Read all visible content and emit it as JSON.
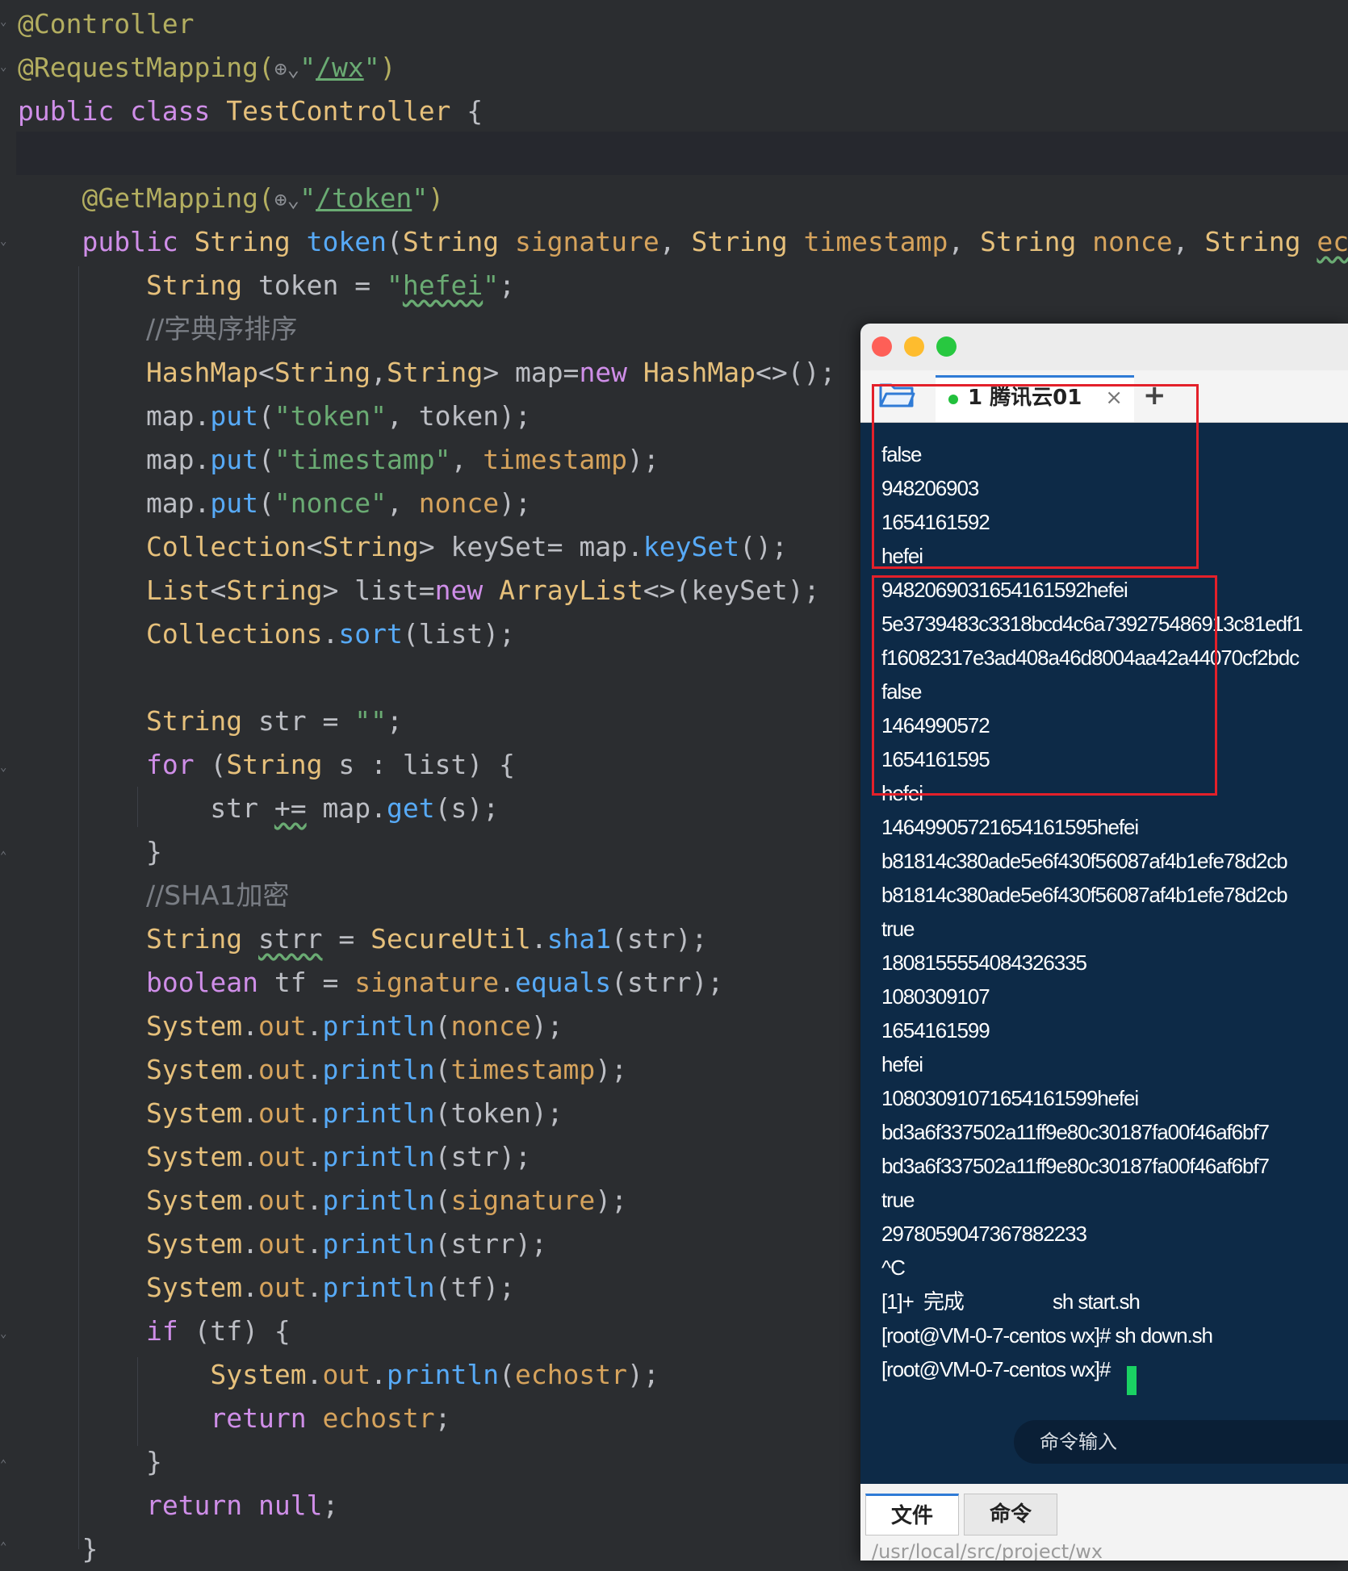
{
  "editor": {
    "lines": [
      [
        {
          "c": "t-ann",
          "t": "@Controller"
        }
      ],
      [
        {
          "c": "t-ann",
          "t": "@RequestMapping("
        },
        {
          "c": "globe",
          "t": "⊕⌄"
        },
        {
          "c": "t-str",
          "t": "\""
        },
        {
          "c": "t-url",
          "t": "/wx"
        },
        {
          "c": "t-str",
          "t": "\""
        },
        {
          "c": "t-ann",
          "t": ")"
        }
      ],
      [
        {
          "c": "t-kw",
          "t": "public class "
        },
        {
          "c": "t-type",
          "t": "TestController"
        },
        {
          "c": "t-pl",
          "t": " {"
        }
      ],
      [],
      [
        {
          "c": "t-pl",
          "t": "    "
        },
        {
          "c": "t-ann",
          "t": "@GetMapping("
        },
        {
          "c": "globe",
          "t": "⊕⌄"
        },
        {
          "c": "t-str",
          "t": "\""
        },
        {
          "c": "t-url",
          "t": "/token"
        },
        {
          "c": "t-str",
          "t": "\""
        },
        {
          "c": "t-ann",
          "t": ")"
        }
      ],
      [
        {
          "c": "t-pl",
          "t": "    "
        },
        {
          "c": "t-kw",
          "t": "public "
        },
        {
          "c": "t-type",
          "t": "String "
        },
        {
          "c": "t-fn",
          "t": "token"
        },
        {
          "c": "t-pl",
          "t": "("
        },
        {
          "c": "t-type",
          "t": "String "
        },
        {
          "c": "t-prm",
          "t": "signature"
        },
        {
          "c": "t-pl",
          "t": ", "
        },
        {
          "c": "t-type",
          "t": "String "
        },
        {
          "c": "t-prm",
          "t": "timestamp"
        },
        {
          "c": "t-pl",
          "t": ", "
        },
        {
          "c": "t-type",
          "t": "String "
        },
        {
          "c": "t-prm",
          "t": "nonce"
        },
        {
          "c": "t-pl",
          "t": ", "
        },
        {
          "c": "t-type",
          "t": "String "
        },
        {
          "c": "t-prm wavy",
          "t": "echos"
        }
      ],
      [
        {
          "c": "t-pl",
          "t": "        "
        },
        {
          "c": "t-type",
          "t": "String "
        },
        {
          "c": "t-pl",
          "t": "token = "
        },
        {
          "c": "t-str",
          "t": "\""
        },
        {
          "c": "t-str wavy",
          "t": "hefei"
        },
        {
          "c": "t-str",
          "t": "\""
        },
        {
          "c": "t-pl",
          "t": ";"
        }
      ],
      [
        {
          "c": "t-pl",
          "t": "        "
        },
        {
          "c": "t-cm",
          "t": "//字典序排序"
        }
      ],
      [
        {
          "c": "t-pl",
          "t": "        "
        },
        {
          "c": "t-type",
          "t": "HashMap"
        },
        {
          "c": "t-pl",
          "t": "<"
        },
        {
          "c": "t-type",
          "t": "String"
        },
        {
          "c": "t-pl",
          "t": ","
        },
        {
          "c": "t-type",
          "t": "String"
        },
        {
          "c": "t-pl",
          "t": "> map="
        },
        {
          "c": "t-kw",
          "t": "new "
        },
        {
          "c": "t-type",
          "t": "HashMap"
        },
        {
          "c": "t-pl",
          "t": "<>();"
        }
      ],
      [
        {
          "c": "t-pl",
          "t": "        map."
        },
        {
          "c": "t-fn",
          "t": "put"
        },
        {
          "c": "t-pl",
          "t": "("
        },
        {
          "c": "t-str",
          "t": "\"token\""
        },
        {
          "c": "t-pl",
          "t": ", token);"
        }
      ],
      [
        {
          "c": "t-pl",
          "t": "        map."
        },
        {
          "c": "t-fn",
          "t": "put"
        },
        {
          "c": "t-pl",
          "t": "("
        },
        {
          "c": "t-str",
          "t": "\"timestamp\""
        },
        {
          "c": "t-pl",
          "t": ", "
        },
        {
          "c": "t-prm",
          "t": "timestamp"
        },
        {
          "c": "t-pl",
          "t": ");"
        }
      ],
      [
        {
          "c": "t-pl",
          "t": "        map."
        },
        {
          "c": "t-fn",
          "t": "put"
        },
        {
          "c": "t-pl",
          "t": "("
        },
        {
          "c": "t-str",
          "t": "\"nonce\""
        },
        {
          "c": "t-pl",
          "t": ", "
        },
        {
          "c": "t-prm",
          "t": "nonce"
        },
        {
          "c": "t-pl",
          "t": ");"
        }
      ],
      [
        {
          "c": "t-pl",
          "t": "        "
        },
        {
          "c": "t-type",
          "t": "Collection"
        },
        {
          "c": "t-pl",
          "t": "<"
        },
        {
          "c": "t-type",
          "t": "String"
        },
        {
          "c": "t-pl",
          "t": "> keySet= map."
        },
        {
          "c": "t-fn",
          "t": "keySet"
        },
        {
          "c": "t-pl",
          "t": "();"
        }
      ],
      [
        {
          "c": "t-pl",
          "t": "        "
        },
        {
          "c": "t-type",
          "t": "List"
        },
        {
          "c": "t-pl",
          "t": "<"
        },
        {
          "c": "t-type",
          "t": "String"
        },
        {
          "c": "t-pl",
          "t": "> list="
        },
        {
          "c": "t-kw",
          "t": "new "
        },
        {
          "c": "t-type",
          "t": "ArrayList"
        },
        {
          "c": "t-pl",
          "t": "<>(keySet);"
        }
      ],
      [
        {
          "c": "t-pl",
          "t": "        "
        },
        {
          "c": "t-type",
          "t": "Collections"
        },
        {
          "c": "t-pl",
          "t": "."
        },
        {
          "c": "t-fn",
          "t": "sort"
        },
        {
          "c": "t-pl",
          "t": "(list);"
        }
      ],
      [],
      [
        {
          "c": "t-pl",
          "t": "        "
        },
        {
          "c": "t-type",
          "t": "String "
        },
        {
          "c": "t-pl",
          "t": "str = "
        },
        {
          "c": "t-str",
          "t": "\"\""
        },
        {
          "c": "t-pl",
          "t": ";"
        }
      ],
      [
        {
          "c": "t-pl",
          "t": "        "
        },
        {
          "c": "t-kw",
          "t": "for "
        },
        {
          "c": "t-pl",
          "t": "("
        },
        {
          "c": "t-type",
          "t": "String "
        },
        {
          "c": "t-pl",
          "t": "s : list) {"
        }
      ],
      [
        {
          "c": "t-pl",
          "t": "            str "
        },
        {
          "c": "t-pl wavy",
          "t": "+="
        },
        {
          "c": "t-pl",
          "t": " map."
        },
        {
          "c": "t-fn",
          "t": "get"
        },
        {
          "c": "t-pl",
          "t": "(s);"
        }
      ],
      [
        {
          "c": "t-pl",
          "t": "        }"
        }
      ],
      [
        {
          "c": "t-pl",
          "t": "        "
        },
        {
          "c": "t-cm",
          "t": "//SHA1加密"
        }
      ],
      [
        {
          "c": "t-pl",
          "t": "        "
        },
        {
          "c": "t-type",
          "t": "String "
        },
        {
          "c": "t-pl wavy",
          "t": "strr"
        },
        {
          "c": "t-pl",
          "t": " = "
        },
        {
          "c": "t-type",
          "t": "SecureUtil"
        },
        {
          "c": "t-pl",
          "t": "."
        },
        {
          "c": "t-fn",
          "t": "sha1"
        },
        {
          "c": "t-pl",
          "t": "(str);"
        }
      ],
      [
        {
          "c": "t-pl",
          "t": "        "
        },
        {
          "c": "t-kw",
          "t": "boolean "
        },
        {
          "c": "t-pl",
          "t": "tf = "
        },
        {
          "c": "t-prm",
          "t": "signature"
        },
        {
          "c": "t-pl",
          "t": "."
        },
        {
          "c": "t-fn",
          "t": "equals"
        },
        {
          "c": "t-pl",
          "t": "(strr);"
        }
      ],
      [
        {
          "c": "t-pl",
          "t": "        "
        },
        {
          "c": "t-type",
          "t": "System"
        },
        {
          "c": "t-pl",
          "t": "."
        },
        {
          "c": "t-prm",
          "t": "out"
        },
        {
          "c": "t-pl",
          "t": "."
        },
        {
          "c": "t-fn",
          "t": "println"
        },
        {
          "c": "t-pl",
          "t": "("
        },
        {
          "c": "t-prm",
          "t": "nonce"
        },
        {
          "c": "t-pl",
          "t": ");"
        }
      ],
      [
        {
          "c": "t-pl",
          "t": "        "
        },
        {
          "c": "t-type",
          "t": "System"
        },
        {
          "c": "t-pl",
          "t": "."
        },
        {
          "c": "t-prm",
          "t": "out"
        },
        {
          "c": "t-pl",
          "t": "."
        },
        {
          "c": "t-fn",
          "t": "println"
        },
        {
          "c": "t-pl",
          "t": "("
        },
        {
          "c": "t-prm",
          "t": "timestamp"
        },
        {
          "c": "t-pl",
          "t": ");"
        }
      ],
      [
        {
          "c": "t-pl",
          "t": "        "
        },
        {
          "c": "t-type",
          "t": "System"
        },
        {
          "c": "t-pl",
          "t": "."
        },
        {
          "c": "t-prm",
          "t": "out"
        },
        {
          "c": "t-pl",
          "t": "."
        },
        {
          "c": "t-fn",
          "t": "println"
        },
        {
          "c": "t-pl",
          "t": "(token);"
        }
      ],
      [
        {
          "c": "t-pl",
          "t": "        "
        },
        {
          "c": "t-type",
          "t": "System"
        },
        {
          "c": "t-pl",
          "t": "."
        },
        {
          "c": "t-prm",
          "t": "out"
        },
        {
          "c": "t-pl",
          "t": "."
        },
        {
          "c": "t-fn",
          "t": "println"
        },
        {
          "c": "t-pl",
          "t": "(str);"
        }
      ],
      [
        {
          "c": "t-pl",
          "t": "        "
        },
        {
          "c": "t-type",
          "t": "System"
        },
        {
          "c": "t-pl",
          "t": "."
        },
        {
          "c": "t-prm",
          "t": "out"
        },
        {
          "c": "t-pl",
          "t": "."
        },
        {
          "c": "t-fn",
          "t": "println"
        },
        {
          "c": "t-pl",
          "t": "("
        },
        {
          "c": "t-prm",
          "t": "signature"
        },
        {
          "c": "t-pl",
          "t": ");"
        }
      ],
      [
        {
          "c": "t-pl",
          "t": "        "
        },
        {
          "c": "t-type",
          "t": "System"
        },
        {
          "c": "t-pl",
          "t": "."
        },
        {
          "c": "t-prm",
          "t": "out"
        },
        {
          "c": "t-pl",
          "t": "."
        },
        {
          "c": "t-fn",
          "t": "println"
        },
        {
          "c": "t-pl",
          "t": "(strr);"
        }
      ],
      [
        {
          "c": "t-pl",
          "t": "        "
        },
        {
          "c": "t-type",
          "t": "System"
        },
        {
          "c": "t-pl",
          "t": "."
        },
        {
          "c": "t-prm",
          "t": "out"
        },
        {
          "c": "t-pl",
          "t": "."
        },
        {
          "c": "t-fn",
          "t": "println"
        },
        {
          "c": "t-pl",
          "t": "(tf);"
        }
      ],
      [
        {
          "c": "t-pl",
          "t": "        "
        },
        {
          "c": "t-kw",
          "t": "if "
        },
        {
          "c": "t-pl",
          "t": "(tf) {"
        }
      ],
      [
        {
          "c": "t-pl",
          "t": "            "
        },
        {
          "c": "t-type",
          "t": "System"
        },
        {
          "c": "t-pl",
          "t": "."
        },
        {
          "c": "t-prm",
          "t": "out"
        },
        {
          "c": "t-pl",
          "t": "."
        },
        {
          "c": "t-fn",
          "t": "println"
        },
        {
          "c": "t-pl",
          "t": "("
        },
        {
          "c": "t-prm",
          "t": "echostr"
        },
        {
          "c": "t-pl",
          "t": ");"
        }
      ],
      [
        {
          "c": "t-pl",
          "t": "            "
        },
        {
          "c": "t-kw",
          "t": "return "
        },
        {
          "c": "t-prm",
          "t": "echostr"
        },
        {
          "c": "t-pl",
          "t": ";"
        }
      ],
      [
        {
          "c": "t-pl",
          "t": "        }"
        }
      ],
      [
        {
          "c": "t-pl",
          "t": "        "
        },
        {
          "c": "t-kw",
          "t": "return null"
        },
        {
          "c": "t-pl",
          "t": ";"
        }
      ],
      [
        {
          "c": "t-pl",
          "t": "    }"
        }
      ]
    ]
  },
  "terminal": {
    "tab_index": "1",
    "tab_label": "腾讯云01",
    "close_glyph": "×",
    "add_glyph": "+",
    "output": [
      "false",
      "948206903",
      "1654161592",
      "hefei",
      "9482069031654161592hefei",
      "5e3739483c3318bcd4c6a739275486913c81edf1",
      "f16082317e3ad408a46d8004aa42a44070cf2bdc",
      "false",
      "1464990572",
      "1654161595",
      "hefei",
      "14649905721654161595hefei",
      "b81814c380ade5e6f430f56087af4b1efe78d2cb",
      "b81814c380ade5e6f430f56087af4b1efe78d2cb",
      "true",
      "1808155554084326335",
      "1080309107",
      "1654161599",
      "hefei",
      "10803091071654161599hefei",
      "bd3a6f337502a11ff9e80c30187fa00f46af6bf7",
      "bd3a6f337502a11ff9e80c30187fa00f46af6bf7",
      "true",
      "2978059047367882233",
      "^C",
      "[1]+  完成                  sh start.sh",
      "[root@VM-0-7-centos wx]# sh down.sh",
      "[root@VM-0-7-centos wx]# "
    ],
    "command_input_placeholder": "命令输入",
    "bottom_tabs": [
      "文件",
      "命令"
    ],
    "current_path": "/usr/local/src/project/wx",
    "colors": {
      "highlight_box": "#e3202a",
      "cursor": "#1ad163",
      "background": "#0d2a47"
    }
  }
}
